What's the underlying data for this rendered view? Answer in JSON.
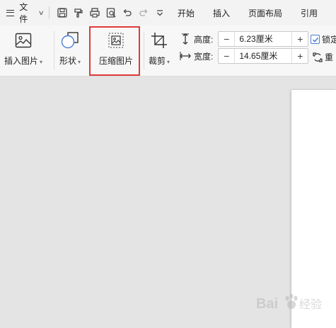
{
  "menu": {
    "file_label": "文件",
    "tabs": [
      "开始",
      "插入",
      "页面布局",
      "引用"
    ]
  },
  "ribbon": {
    "insert_picture": "插入图片",
    "shape": "形状",
    "compress_picture": "压缩图片",
    "crop": "裁剪",
    "height_label": "高度:",
    "height_value": "6.23厘米",
    "width_label": "宽度:",
    "width_value": "14.65厘米",
    "minus": "−",
    "plus": "+",
    "lock_label": "锁定",
    "reset_label": "重"
  },
  "colors": {
    "highlight": "#e03a3a",
    "accent": "#4a7fd6"
  },
  "watermark": {
    "text": "Bai 经验"
  }
}
